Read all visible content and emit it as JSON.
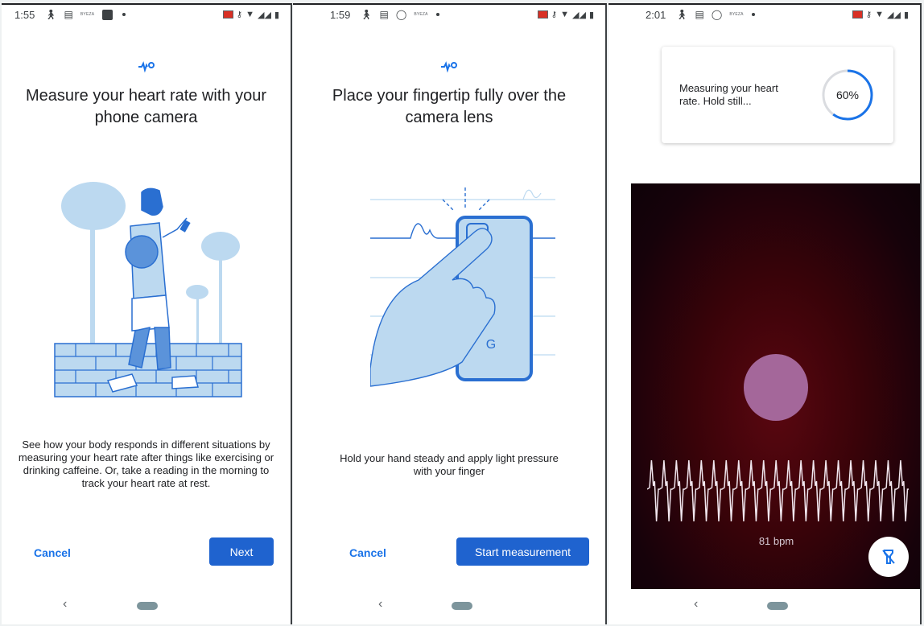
{
  "screens": [
    {
      "status": {
        "time": "1:55",
        "carrier_text": "BYEZA"
      },
      "title": "Measure your heart rate with your phone camera",
      "description": "See how your body responds in different situations by measuring your heart rate after things like exercising or drinking caffeine. Or, take a reading in the morning to track your heart rate at rest.",
      "cancel_label": "Cancel",
      "primary_label": "Next"
    },
    {
      "status": {
        "time": "1:59",
        "carrier_text": "BYEZA"
      },
      "title": "Place your fingertip fully over the camera lens",
      "description": "Hold your hand steady and apply light pressure with your finger",
      "cancel_label": "Cancel",
      "primary_label": "Start measurement",
      "phone_logo": "G"
    },
    {
      "status": {
        "time": "2:01",
        "carrier_text": "BYEZA"
      },
      "card_text": "Measuring your heart rate. Hold still...",
      "progress_percent": 60,
      "progress_label": "60%",
      "bpm_label": "81 bpm",
      "flash_button_icon": "flashlight-off-icon"
    }
  ],
  "logo_glyph": "ECG",
  "colors": {
    "accent": "#1a73e8",
    "button": "#1f63cf",
    "progress_track": "#dadce0"
  }
}
